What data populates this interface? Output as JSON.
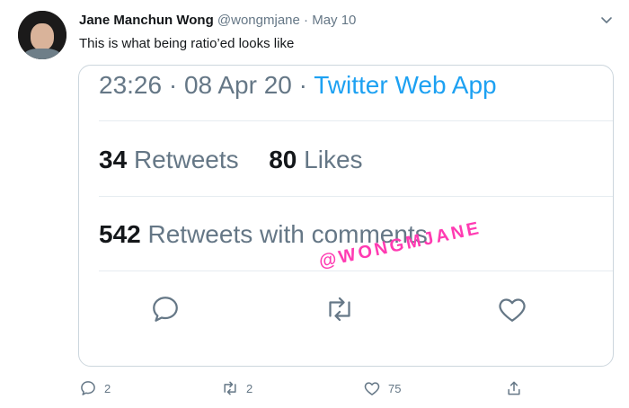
{
  "tweet": {
    "author_name": "Jane Manchun Wong",
    "author_handle": "@wongmjane",
    "dot": "·",
    "date": "May 10",
    "text": "This is what being ratio’ed looks like"
  },
  "screenshot_card": {
    "time": "23:26",
    "sep1": "·",
    "date": "08 Apr 20",
    "sep2": "·",
    "app": "Twitter Web App",
    "retweets_count": "34",
    "retweets_label": "Retweets",
    "likes_count": "80",
    "likes_label": "Likes",
    "comments_count": "542",
    "comments_label": "Retweets with comments",
    "watermark": "@WONGMJANE"
  },
  "actions": {
    "reply_count": "2",
    "retweet_count": "2",
    "like_count": "75"
  },
  "icons": [
    "avatar",
    "chevron-down-icon",
    "reply-icon",
    "retweet-icon",
    "like-icon",
    "share-icon"
  ],
  "colors": {
    "accent": "#1da1f2",
    "muted": "#657786",
    "watermark": "#ff3bb2"
  }
}
